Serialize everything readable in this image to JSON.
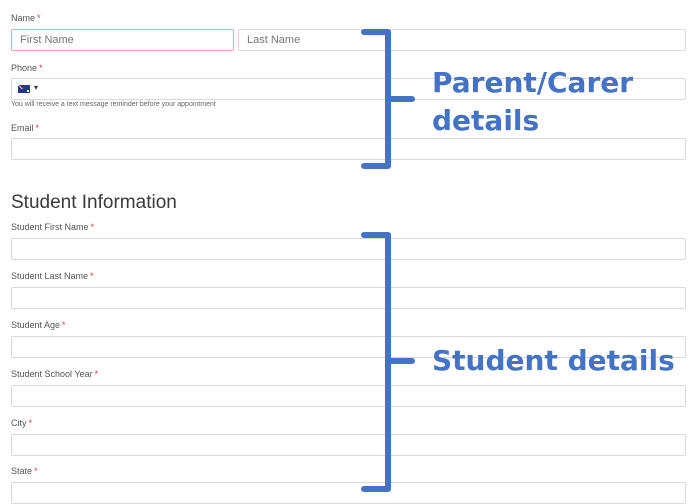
{
  "parent": {
    "name_label": "Name",
    "first_name_placeholder": "First Name",
    "last_name_placeholder": "Last Name",
    "phone_label": "Phone",
    "phone_hint": "You will receive a text message reminder before your appointment",
    "email_label": "Email",
    "required_marker": "*"
  },
  "student": {
    "section_title": "Student Information",
    "first_name_label": "Student First Name",
    "last_name_label": "Student Last Name",
    "age_label": "Student Age",
    "school_year_label": "Student School Year",
    "city_label": "City",
    "state_label": "State"
  },
  "annotations": {
    "parent_line1": "Parent/Carer",
    "parent_line2": "details",
    "student": "Student details",
    "color": "#4472c4"
  },
  "icons": {
    "flag": "australia-flag-icon",
    "caret": "caret-down-icon"
  }
}
